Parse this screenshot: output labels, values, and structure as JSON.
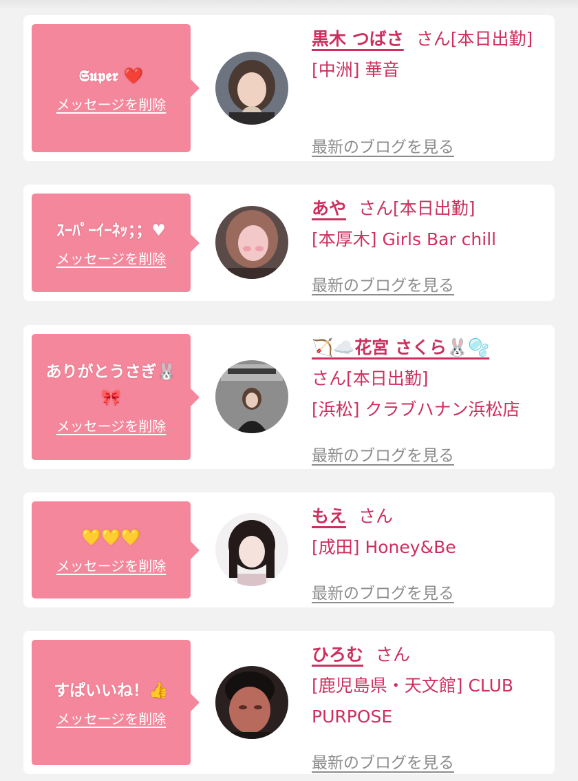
{
  "delete_label": "メッセージを削除",
  "blog_label": "最新のブログを見る",
  "colors": {
    "accent_pink": "#f4879c",
    "name_pink": "#cc2f5e",
    "link_gray": "#8c8c8c",
    "page_bg": "#f2f2f2"
  },
  "messages": [
    {
      "bubble_text": "𝕾𝖚𝖕𝖊𝖗 ❤️",
      "name": "黒木 つばさ",
      "suffix": "さん[本日出勤]",
      "shop": "[中洲] 華音",
      "avatar_icon": "girl-portrait-icon"
    },
    {
      "bubble_text": "ｽｰﾊﾟｰｲｰﾈｯ；；♥",
      "name": "あや",
      "suffix": "さん[本日出勤]",
      "shop": "[本厚木] Girls Bar chill",
      "avatar_icon": "girl-portrait-icon"
    },
    {
      "bubble_text": "ありがとうさぎ🐰🎀",
      "name": "🏹☁️花宮 さくら🐰🫧",
      "suffix": "さん[本日出勤]",
      "shop": "[浜松] クラブハナン浜松店",
      "avatar_icon": "poster-photo-icon"
    },
    {
      "bubble_text": "💛💛💛",
      "name": "もえ",
      "suffix": "さん",
      "shop": "[成田] Honey&Be",
      "avatar_icon": "girl-portrait-icon"
    },
    {
      "bubble_text": "すぱいいね！👍",
      "name": "ひろむ",
      "suffix": "さん",
      "shop": "[鹿児島県・天文館] CLUB PURPOSE",
      "avatar_icon": "man-portrait-icon"
    }
  ]
}
